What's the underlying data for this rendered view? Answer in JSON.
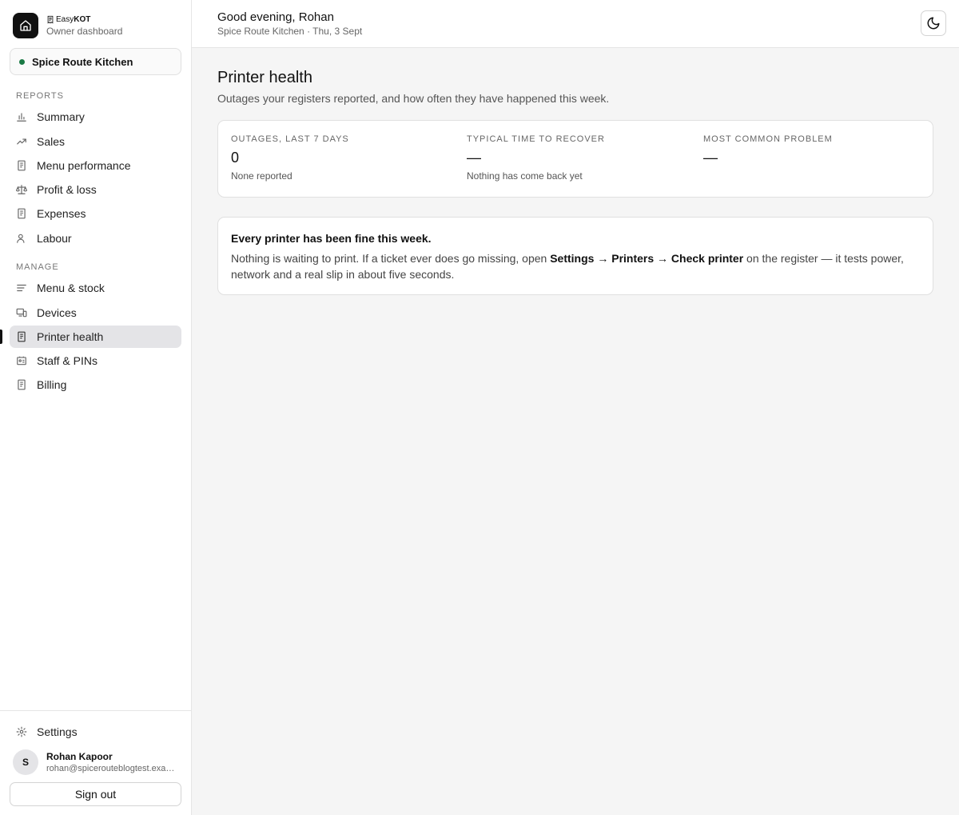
{
  "brand": {
    "name_prefix": "Easy",
    "name_suffix": "KOT",
    "subtitle": "Owner dashboard"
  },
  "store": {
    "name": "Spice Route Kitchen",
    "status_color": "#1a7a45"
  },
  "sidebar": {
    "reports_label": "REPORTS",
    "reports": [
      {
        "label": "Summary",
        "icon": "bar-chart-icon"
      },
      {
        "label": "Sales",
        "icon": "trend-up-icon"
      },
      {
        "label": "Menu performance",
        "icon": "receipt-icon"
      },
      {
        "label": "Profit & loss",
        "icon": "scale-icon"
      },
      {
        "label": "Expenses",
        "icon": "receipt-icon"
      },
      {
        "label": "Labour",
        "icon": "user-icon"
      }
    ],
    "manage_label": "MANAGE",
    "manage": [
      {
        "label": "Menu & stock",
        "icon": "lines-icon"
      },
      {
        "label": "Devices",
        "icon": "devices-icon"
      },
      {
        "label": "Printer health",
        "icon": "receipt-icon",
        "active": true
      },
      {
        "label": "Staff & PINs",
        "icon": "id-card-icon"
      },
      {
        "label": "Billing",
        "icon": "receipt-icon"
      }
    ],
    "settings_label": "Settings"
  },
  "user": {
    "initial": "S",
    "name": "Rohan Kapoor",
    "email": "rohan@spicerouteblogtest.example.com",
    "signout_label": "Sign out"
  },
  "topbar": {
    "greeting": "Good evening, Rohan",
    "subtitle": "Spice Route Kitchen · Thu, 3 Sept",
    "theme_icon": "moon-icon"
  },
  "page": {
    "title": "Printer health",
    "subtitle": "Outages your registers reported, and how often they have happened this week."
  },
  "stats": [
    {
      "label": "OUTAGES, LAST 7 DAYS",
      "value": "0",
      "note": "None reported"
    },
    {
      "label": "TYPICAL TIME TO RECOVER",
      "value": "—",
      "note": "Nothing has come back yet"
    },
    {
      "label": "MOST COMMON PROBLEM",
      "value": "—",
      "note": ""
    }
  ],
  "info": {
    "title": "Every printer has been fine this week.",
    "body_pre": "Nothing is waiting to print. If a ticket ever does go missing, open ",
    "body_bold": "Settings → Printers → Check printer",
    "body_post": " on the register — it tests power, network and a real slip in about five seconds."
  }
}
